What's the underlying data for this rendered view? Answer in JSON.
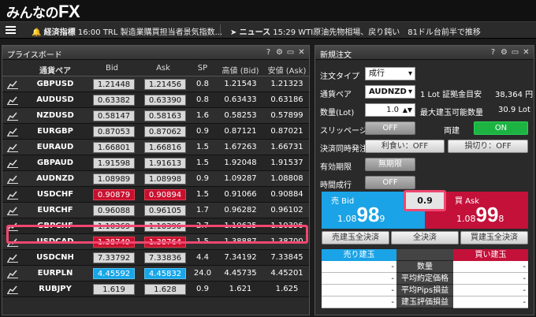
{
  "app": {
    "logo_prefix": "みんなの",
    "logo_fx": "FX"
  },
  "ticker": {
    "econ_label": "経済指標",
    "econ_text": "16:00 TRL 製造業購買担当者景気指数...",
    "news_label": "ニュース",
    "news_text": "15:29 WTI原油先物相場、戻り鈍い　81ドル台前半で推移"
  },
  "priceboard": {
    "title": "プライスボード",
    "headers": {
      "pair": "通貨ペア",
      "bid": "Bid",
      "ask": "Ask",
      "sp": "SP",
      "high": "高値 (Bid)",
      "low": "安値 (Ask)"
    },
    "rows": [
      {
        "pair": "GBPUSD",
        "bid": "1.21448",
        "ask": "1.21456",
        "sp": "0.8",
        "high": "1.21543",
        "low": "1.21323",
        "bid_color": "gray",
        "ask_color": "gray"
      },
      {
        "pair": "AUDUSD",
        "bid": "0.63382",
        "ask": "0.63390",
        "sp": "0.8",
        "high": "0.63433",
        "low": "0.63186",
        "bid_color": "gray",
        "ask_color": "gray"
      },
      {
        "pair": "NZDUSD",
        "bid": "0.58147",
        "ask": "0.58163",
        "sp": "1.6",
        "high": "0.58253",
        "low": "0.57899",
        "bid_color": "gray",
        "ask_color": "gray"
      },
      {
        "pair": "EURGBP",
        "bid": "0.87053",
        "ask": "0.87062",
        "sp": "0.9",
        "high": "0.87121",
        "low": "0.87021",
        "bid_color": "gray",
        "ask_color": "gray"
      },
      {
        "pair": "EURAUD",
        "bid": "1.66801",
        "ask": "1.66816",
        "sp": "1.5",
        "high": "1.67263",
        "low": "1.66731",
        "bid_color": "gray",
        "ask_color": "gray"
      },
      {
        "pair": "GBPAUD",
        "bid": "1.91598",
        "ask": "1.91613",
        "sp": "1.5",
        "high": "1.92048",
        "low": "1.91537",
        "bid_color": "gray",
        "ask_color": "gray"
      },
      {
        "pair": "AUDNZD",
        "bid": "1.08989",
        "ask": "1.08998",
        "sp": "0.9",
        "high": "1.09287",
        "low": "1.08808",
        "bid_color": "gray",
        "ask_color": "gray"
      },
      {
        "pair": "USDCHF",
        "bid": "0.90879",
        "ask": "0.90894",
        "sp": "1.5",
        "high": "0.91066",
        "low": "0.90884",
        "bid_color": "red",
        "ask_color": "red"
      },
      {
        "pair": "EURCHF",
        "bid": "0.96088",
        "ask": "0.96105",
        "sp": "1.7",
        "high": "0.96282",
        "low": "0.96102",
        "bid_color": "gray",
        "ask_color": "gray"
      },
      {
        "pair": "GBPCHF",
        "bid": "1.10369",
        "ask": "1.10396",
        "sp": "2.7",
        "high": "1.10625",
        "low": "1.10396",
        "bid_color": "gray",
        "ask_color": "gray"
      },
      {
        "pair": "USDCAD",
        "bid": "1.38749",
        "ask": "1.38764",
        "sp": "1.5",
        "high": "1.38887",
        "low": "1.38700",
        "bid_color": "red",
        "ask_color": "red"
      },
      {
        "pair": "USDCNH",
        "bid": "7.33792",
        "ask": "7.33836",
        "sp": "4.4",
        "high": "7.34192",
        "low": "7.33845",
        "bid_color": "gray",
        "ask_color": "gray"
      },
      {
        "pair": "EURPLN",
        "bid": "4.45592",
        "ask": "4.45832",
        "sp": "24.0",
        "high": "4.45735",
        "low": "4.45201",
        "bid_color": "blue",
        "ask_color": "blue"
      },
      {
        "pair": "RUBJPY",
        "bid": "1.619",
        "ask": "1.628",
        "sp": "0.9",
        "high": "1.621",
        "low": "1.625",
        "bid_color": "gray",
        "ask_color": "gray"
      }
    ]
  },
  "order": {
    "title": "新規注文",
    "order_type_label": "注文タイプ",
    "order_type_value": "成行",
    "pair_label": "通貨ペア",
    "pair_value": "AUDNZD",
    "margin_label": "1 Lot 証拠金目安",
    "margin_value": "38,364 円",
    "qty_label": "数量(Lot)",
    "qty_value": "1.0",
    "max_label": "最大建玉可能数量",
    "max_value": "30.9 Lot",
    "slippage_label": "スリッページ",
    "slippage_value": "OFF",
    "both_label": "両建",
    "both_value": "ON",
    "settle_label": "決済同時発注",
    "take_profit": "利食い：OFF",
    "stop_loss": "損切り：OFF",
    "expiry_label": "有効期限",
    "expiry_value": "無期限",
    "time_label": "時間成行",
    "time_value": "OFF",
    "sell_label": "売 Bid",
    "sell_pre": "1.08",
    "sell_big": "98",
    "sell_post": "9",
    "buy_label": "買 Ask",
    "buy_pre": "1.08",
    "buy_big": "99",
    "buy_post": "8",
    "spread": "0.9",
    "btn_sell_all": "売建玉全決済",
    "btn_all": "全決済",
    "btn_buy_all": "買建玉全決済",
    "sell_pos": "売り建玉",
    "buy_pos": "買い建玉",
    "pos_rows": [
      {
        "left": "-",
        "label": "数量",
        "right": "-"
      },
      {
        "left": "-",
        "label": "平均約定価格",
        "right": "-"
      },
      {
        "left": "-",
        "label": "平均Pips損益",
        "right": "-"
      },
      {
        "left": "-",
        "label": "建玉評価損益",
        "right": "-"
      }
    ]
  }
}
